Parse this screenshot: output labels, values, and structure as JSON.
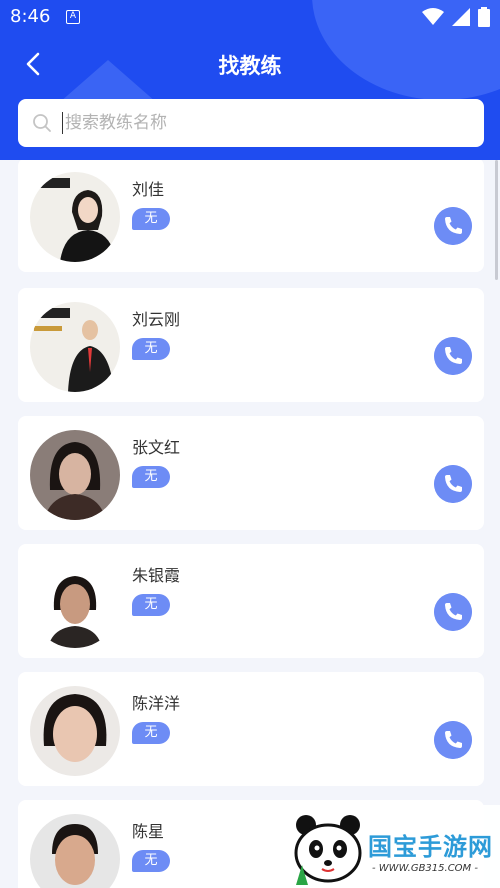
{
  "status": {
    "time": "8:46",
    "a_icon": "A"
  },
  "header": {
    "title": "找教练",
    "back_icon": "chevron-left-icon"
  },
  "search": {
    "placeholder": "搜索教练名称"
  },
  "coaches": [
    {
      "name": "刘佳",
      "badge": "无"
    },
    {
      "name": "刘云刚",
      "badge": "无"
    },
    {
      "name": "张文红",
      "badge": "无"
    },
    {
      "name": "朱银霞",
      "badge": "无"
    },
    {
      "name": "陈洋洋",
      "badge": "无"
    },
    {
      "name": "陈星",
      "badge": "无"
    }
  ],
  "watermark": {
    "brand": "国宝手游网",
    "url": "- WWW.GB315.COM -"
  },
  "colors": {
    "header": "#1f4cf0",
    "accent": "#6d8cf5",
    "background": "#f3f5fb"
  }
}
